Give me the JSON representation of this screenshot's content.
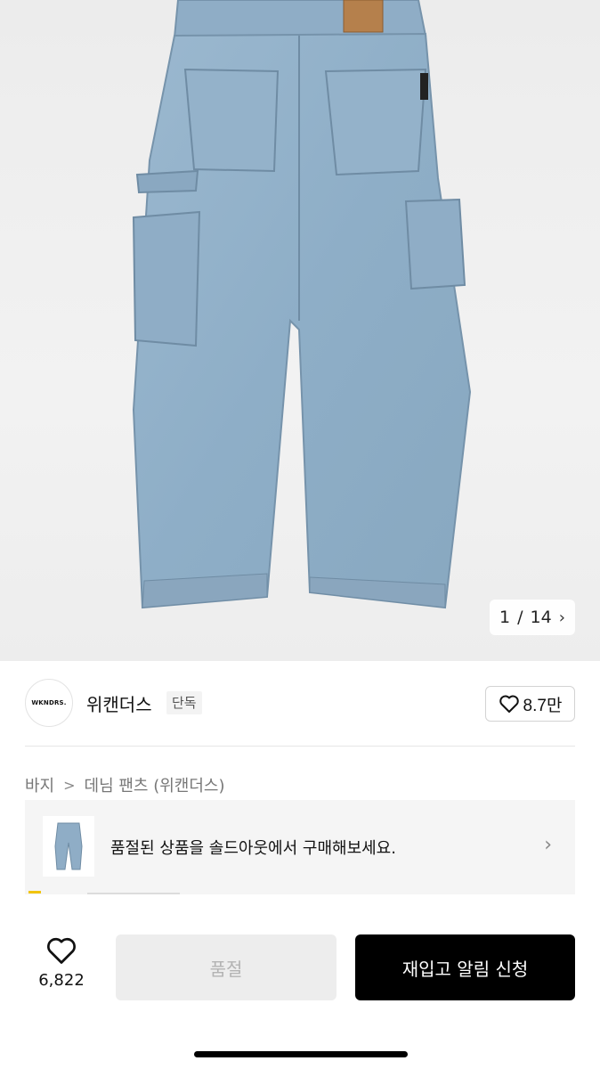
{
  "gallery": {
    "current": "1",
    "separator": "/",
    "total": "14",
    "next_icon": "chevron-right-icon"
  },
  "brand": {
    "logo_text": "WKNDRS.",
    "name": "위캔더스",
    "badge": "단독",
    "like_count": "8.7만"
  },
  "breadcrumb": {
    "level1": "바지",
    "separator": ">",
    "level2": "데님 팬츠 (위캔더스)"
  },
  "soldout_banner": {
    "text": "품절된 상품을 솔드아웃에서 구매해보세요.",
    "chevron_icon": "chevron-right-icon"
  },
  "bottom_bar": {
    "wish_count": "6,822",
    "soldout_label": "품절",
    "restock_label": "재입고 알림 신청"
  },
  "colors": {
    "primary_button": "#000000",
    "disabled_button": "#ededed",
    "denim": "#8fb0c9"
  }
}
